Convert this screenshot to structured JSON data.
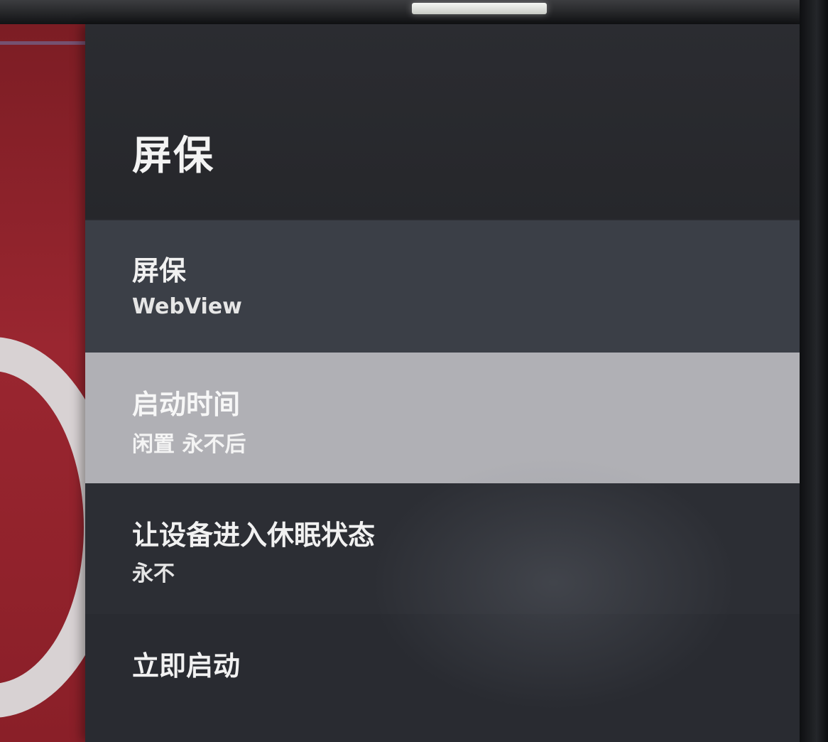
{
  "screen_saver_panel": {
    "title": "屏保",
    "items": [
      {
        "label": "屏保",
        "value": "WebView"
      },
      {
        "label": "启动时间",
        "value": "闲置 永不后"
      },
      {
        "label": "让设备进入休眠状态",
        "value": "永不"
      },
      {
        "label": "立即启动"
      }
    ],
    "focused_item_index": 1
  },
  "colors": {
    "panel_background": "#2a2b30",
    "focused_row": "#b0b0b5",
    "text": "#f1f1f1",
    "background_app_accent": "#9a2630"
  }
}
